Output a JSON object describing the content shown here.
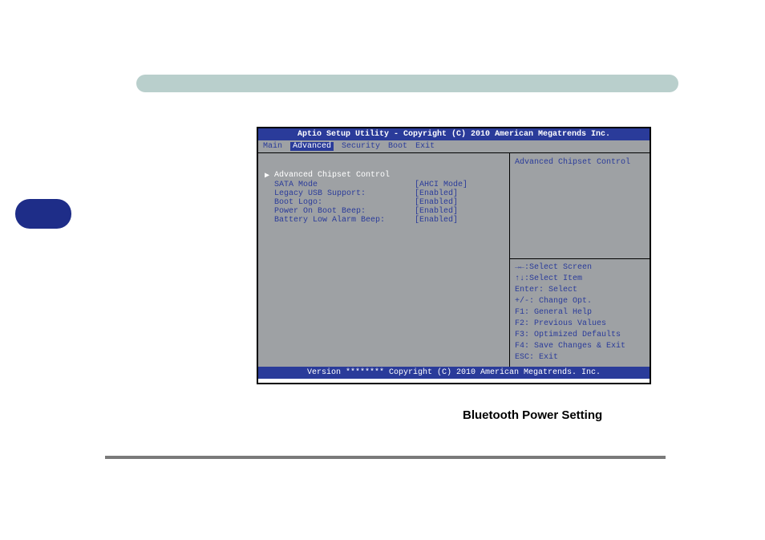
{
  "bios": {
    "title": "Aptio Setup Utility - Copyright (C) 2010 American Megatrends Inc.",
    "tabs": [
      "Main",
      "Advanced",
      "Security",
      "Boot",
      "Exit"
    ],
    "active_tab": "Advanced",
    "heading": "Advanced Chipset Control",
    "items": [
      {
        "label": "SATA Mode",
        "value": "[AHCI Mode]"
      },
      {
        "label": "Legacy USB Support:",
        "value": "[Enabled]"
      },
      {
        "label": "Boot Logo:",
        "value": "[Enabled]"
      },
      {
        "label": "Power On Boot Beep:",
        "value": "[Enabled]"
      },
      {
        "label": "Battery Low Alarm Beep:",
        "value": "[Enabled]"
      }
    ],
    "right_desc": "Advanced Chipset Control",
    "keys": [
      "→←:Select Screen",
      "↑↓:Select Item",
      "Enter: Select",
      "+/-: Change Opt.",
      "F1: General Help",
      "F2: Previous Values",
      "F3: Optimized Defaults",
      "F4: Save Changes & Exit",
      "ESC: Exit"
    ],
    "footer": "Version ******** Copyright (C) 2010 American Megatrends. Inc."
  },
  "caption": "Bluetooth Power Setting"
}
